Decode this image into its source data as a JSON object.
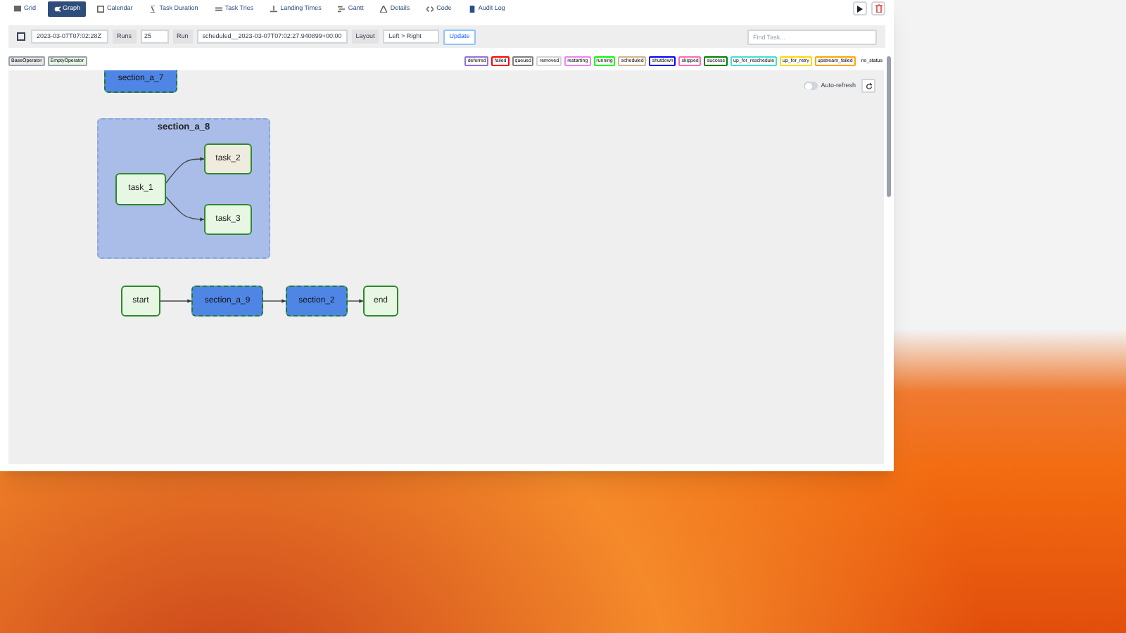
{
  "nav_tabs": [
    {
      "label": "Grid",
      "selected": false
    },
    {
      "label": "Graph",
      "selected": true
    },
    {
      "label": "Calendar",
      "selected": false
    },
    {
      "label": "Task Duration",
      "selected": false
    },
    {
      "label": "Task Tries",
      "selected": false
    },
    {
      "label": "Landing Times",
      "selected": false
    },
    {
      "label": "Gantt",
      "selected": false
    },
    {
      "label": "Details",
      "selected": false
    },
    {
      "label": "Code",
      "selected": false
    },
    {
      "label": "Audit Log",
      "selected": false
    }
  ],
  "filters": {
    "date": "2023-03-07T07:02:28Z",
    "runs_label": "Runs",
    "runs": "25",
    "run_label": "Run",
    "run": "scheduled__2023-03-07T07:02:27.940899+00:00",
    "layout_label": "Layout",
    "layout": "Left > Right",
    "update": "Update",
    "search_placeholder": "Find Task..."
  },
  "operators": [
    {
      "label": "BaseOperator",
      "color": "#e8e8e8"
    },
    {
      "label": "EmptyOperator",
      "color": "#e8f7e4"
    }
  ],
  "legend": [
    {
      "label": "deferred",
      "color": "#9370db"
    },
    {
      "label": "failed",
      "color": "#ff0000"
    },
    {
      "label": "queued",
      "color": "#808080"
    },
    {
      "label": "removed",
      "color": "#d3d3d3"
    },
    {
      "label": "restarting",
      "color": "#ee82ee"
    },
    {
      "label": "running",
      "color": "#00ff00"
    },
    {
      "label": "scheduled",
      "color": "#d2b48c"
    },
    {
      "label": "shutdown",
      "color": "#0000ff"
    },
    {
      "label": "skipped",
      "color": "#ff69b4"
    },
    {
      "label": "success",
      "color": "#008000"
    },
    {
      "label": "up_for_reschedule",
      "color": "#40e0d0"
    },
    {
      "label": "up_for_retry",
      "color": "#ffd700"
    },
    {
      "label": "upstream_failed",
      "color": "#ffa500"
    },
    {
      "label": "no_status",
      "color": "#ffffff"
    }
  ],
  "auto_refresh": {
    "label": "Auto-refresh",
    "on": false
  },
  "graph": {
    "nodes": [
      {
        "label": "section_a_7",
        "kind": "group_collapsed",
        "color": "#4f86e6"
      },
      {
        "label": "section_a_8",
        "kind": "group_expanded",
        "color": "#a9bde8"
      },
      {
        "label": "task_1",
        "kind": "task",
        "color": "#e8f7e4"
      },
      {
        "label": "task_2",
        "kind": "task",
        "color": "#f0ebdf"
      },
      {
        "label": "task_3",
        "kind": "task",
        "color": "#e8f7e4"
      },
      {
        "label": "start",
        "kind": "task",
        "color": "#e8f7e4"
      },
      {
        "label": "section_a_9",
        "kind": "group_collapsed",
        "color": "#4f86e6"
      },
      {
        "label": "section_2",
        "kind": "group_collapsed",
        "color": "#4f86e6"
      },
      {
        "label": "end",
        "kind": "task",
        "color": "#e8f7e4"
      }
    ]
  }
}
